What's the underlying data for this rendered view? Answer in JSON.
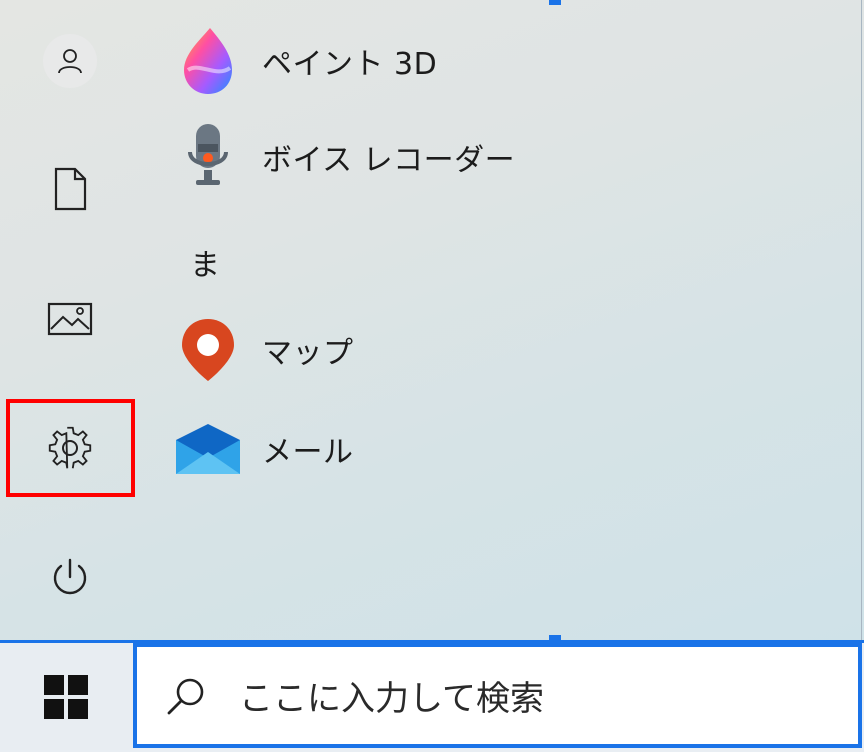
{
  "start_menu": {
    "rail": {
      "items": [
        {
          "icon": "user-icon",
          "label": ""
        },
        {
          "icon": "document-icon",
          "label": ""
        },
        {
          "icon": "pictures-icon",
          "label": ""
        },
        {
          "icon": "gear-icon",
          "label": ""
        },
        {
          "icon": "power-icon",
          "label": ""
        }
      ]
    },
    "apps": [
      {
        "label": "ペイント 3D",
        "icon": "paint-3d-icon"
      },
      {
        "label": "ボイス レコーダー",
        "icon": "voice-recorder-icon"
      },
      {
        "label": "マップ",
        "icon": "maps-icon"
      },
      {
        "label": "メール",
        "icon": "mail-icon"
      }
    ],
    "section_header": "ま"
  },
  "taskbar": {
    "start_icon": "windows-logo-icon",
    "search": {
      "placeholder": "ここに入力して検索",
      "icon": "search-icon"
    }
  },
  "colors": {
    "accent": "#1a73e8",
    "highlight": "#ff0000"
  }
}
